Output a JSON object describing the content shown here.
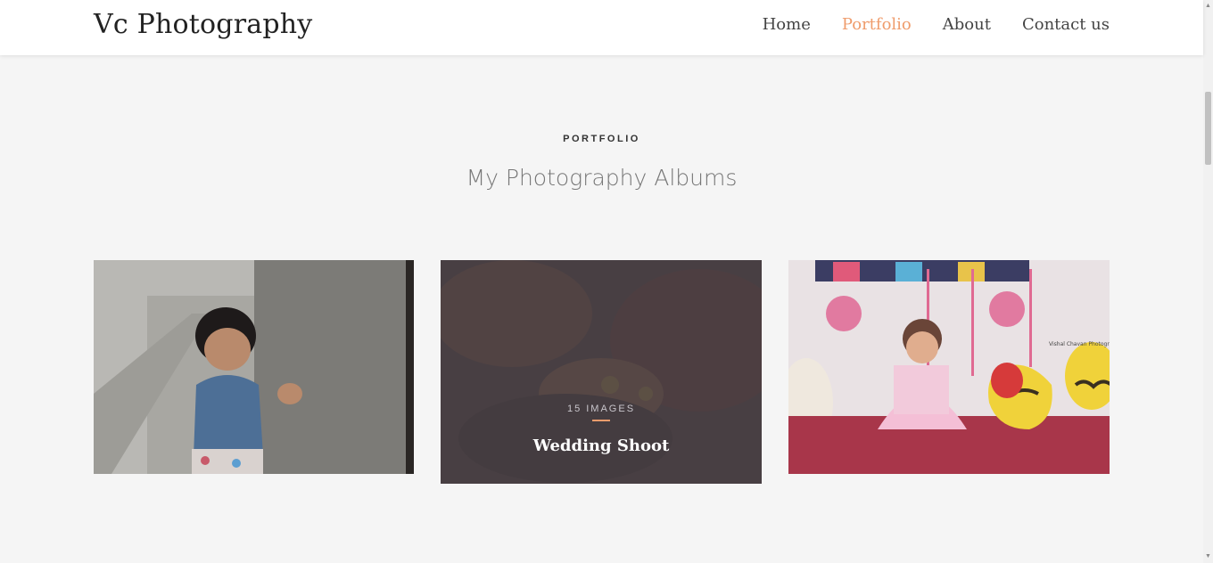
{
  "header": {
    "brand": "Vc Photography",
    "nav": [
      {
        "label": "Home",
        "active": false
      },
      {
        "label": "Portfolio",
        "active": true
      },
      {
        "label": "About",
        "active": false
      },
      {
        "label": "Contact us",
        "active": false
      }
    ]
  },
  "section": {
    "kicker": "PORTFOLIO",
    "title": "My Photography Albums"
  },
  "albums": [
    {
      "image": "toddler-at-concrete-pillar"
    },
    {
      "image": "wedding-hands",
      "count": "15 IMAGES",
      "title": "Wedding Shoot"
    },
    {
      "image": "baby-girl-pink-dress-birthday"
    }
  ],
  "colors": {
    "accent": "#ef9c6c",
    "background": "#f5f5f5",
    "header": "#ffffff"
  },
  "scrollbar": {
    "up_icon": "▲",
    "down_icon": "▼"
  }
}
